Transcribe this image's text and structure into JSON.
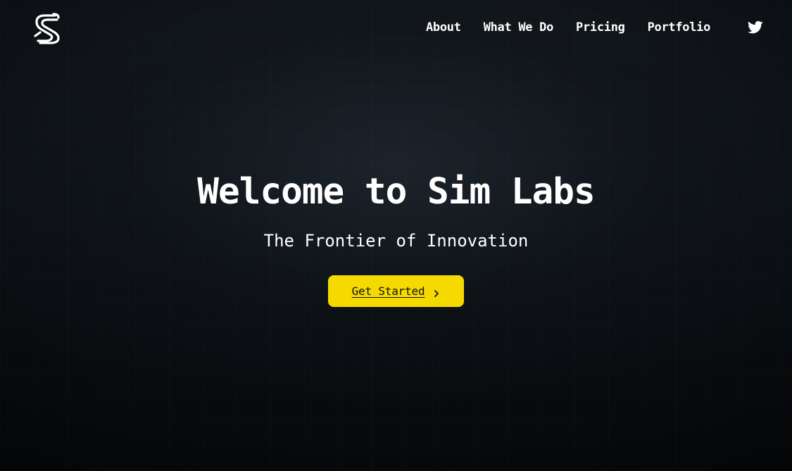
{
  "brand": {
    "logo_icon": "sim-labs-s-logo-icon"
  },
  "nav": {
    "items": [
      {
        "label": "About"
      },
      {
        "label": "What We Do"
      },
      {
        "label": "Pricing"
      },
      {
        "label": "Portfolio"
      }
    ],
    "social_icon": "twitter-icon"
  },
  "hero": {
    "title": "Welcome to Sim Labs",
    "subtitle": "The Frontier of Innovation",
    "cta_label": "Get Started",
    "cta_icon": "chevron-right-icon"
  },
  "colors": {
    "background": "#0a0d11",
    "text": "#ffffff",
    "accent": "#f4da00",
    "button_text": "#111111"
  }
}
